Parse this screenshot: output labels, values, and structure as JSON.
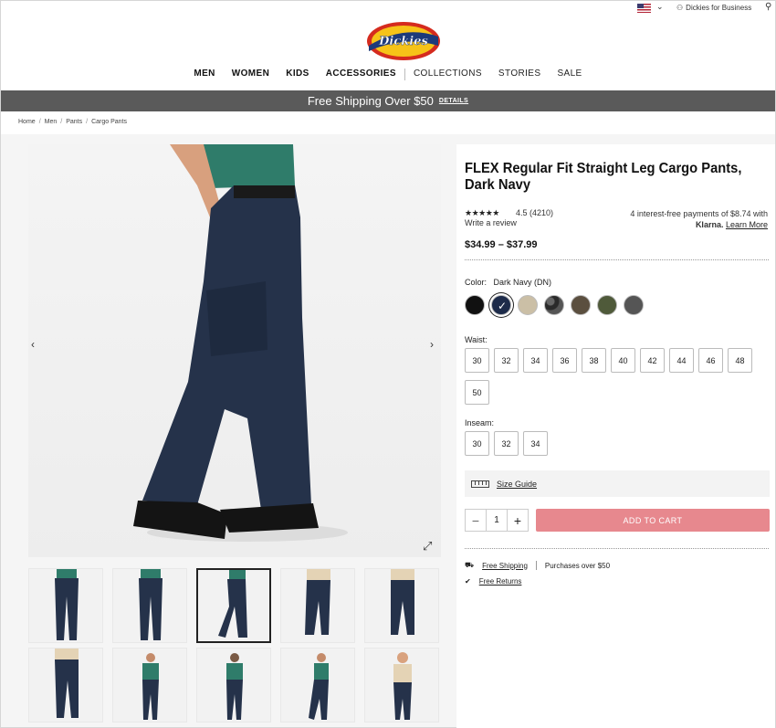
{
  "topbar": {
    "business_label": "Dickies for Business"
  },
  "logo": {
    "text": "Dickies"
  },
  "nav": {
    "items_bold": [
      "MEN",
      "WOMEN",
      "KIDS",
      "ACCESSORIES"
    ],
    "items_light": [
      "COLLECTIONS",
      "STORIES",
      "SALE"
    ]
  },
  "promo": {
    "text": "Free Shipping Over $50",
    "details": "DETAILS"
  },
  "breadcrumb": [
    "Home",
    "Men",
    "Pants",
    "Cargo Pants"
  ],
  "product": {
    "title": "FLEX Regular Fit Straight Leg Cargo Pants, Dark Navy",
    "stars": "★★★★★",
    "rating": "4.5 (4210)",
    "write_review": "Write a review",
    "klarna_line1": "4 interest-free payments of $8.74 with",
    "klarna_brand": "Klarna.",
    "klarna_learn": "Learn More",
    "price": "$34.99 – $37.99",
    "color_label": "Color:",
    "color_value": "Dark Navy (DN)",
    "swatches": [
      "#111111",
      "#1d2b4a",
      "#cbbfa6",
      "#3a3a3a",
      "#5b4f3f",
      "#4f5a3a",
      "#555555"
    ],
    "waist_label": "Waist:",
    "waist": [
      "30",
      "32",
      "34",
      "36",
      "38",
      "40",
      "42",
      "44",
      "46",
      "48",
      "50"
    ],
    "inseam_label": "Inseam:",
    "inseam": [
      "30",
      "32",
      "34"
    ],
    "size_guide": "Size Guide",
    "qty": "1",
    "qty_minus": "−",
    "qty_plus": "+",
    "add_to_cart": "ADD TO CART",
    "free_shipping": "Free Shipping",
    "free_shipping_note": "Purchases over $50",
    "free_returns": "Free Returns"
  },
  "colors": {
    "navy": "#2b3a55",
    "cart": "#e7888e",
    "promo_bg": "#5a5a5a"
  }
}
